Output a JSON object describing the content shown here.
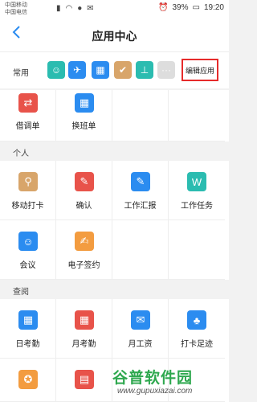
{
  "statusbar": {
    "carrier1": "中国移动",
    "carrier2": "中国电信",
    "battery": "39%",
    "time": "19:20"
  },
  "header": {
    "title": "应用中心",
    "back_icon": "chevron-left-icon"
  },
  "common": {
    "label": "常用",
    "edit_label": "编辑应用",
    "apps": [
      {
        "icon": "person-icon",
        "color": "#2bbcb0"
      },
      {
        "icon": "plane-icon",
        "color": "#2b8cf0"
      },
      {
        "icon": "calendar-icon",
        "color": "#2b8cf0"
      },
      {
        "icon": "check-icon",
        "color": "#d8a56a"
      },
      {
        "icon": "stamp-icon",
        "color": "#2bbcb0"
      },
      {
        "icon": "more-icon",
        "color": "#dddddd"
      }
    ]
  },
  "top_apps": [
    {
      "label": "借调单",
      "icon": "transfer-icon",
      "color": "#e8534a"
    },
    {
      "label": "换班单",
      "icon": "shift-icon",
      "color": "#2b8cf0"
    }
  ],
  "sections": {
    "personal": "个人",
    "query": "查阅"
  },
  "personal_apps": [
    {
      "label": "移动打卡",
      "icon": "location-pin-icon",
      "color": "#d8a56a"
    },
    {
      "label": "确认",
      "icon": "pen-icon",
      "color": "#e8534a"
    },
    {
      "label": "工作汇报",
      "icon": "report-icon",
      "color": "#2b8cf0"
    },
    {
      "label": "工作任务",
      "icon": "task-icon",
      "color": "#2bbcb0"
    },
    {
      "label": "会议",
      "icon": "meeting-icon",
      "color": "#2b8cf0"
    },
    {
      "label": "电子签约",
      "icon": "contract-icon",
      "color": "#f39c40"
    }
  ],
  "query_apps": [
    {
      "label": "日考勤",
      "icon": "calendar-day-icon",
      "color": "#2b8cf0"
    },
    {
      "label": "月考勤",
      "icon": "calendar-month-icon",
      "color": "#e8534a"
    },
    {
      "label": "月工资",
      "icon": "salary-icon",
      "color": "#2b8cf0"
    },
    {
      "label": "打卡足迹",
      "icon": "footprint-icon",
      "color": "#2b8cf0"
    },
    {
      "label": "",
      "icon": "medal-icon",
      "color": "#f39c40"
    },
    {
      "label": "",
      "icon": "gift-icon",
      "color": "#e8534a"
    }
  ],
  "watermark": {
    "main": "谷普软件园",
    "url": "www.gupuxiazai.com"
  }
}
